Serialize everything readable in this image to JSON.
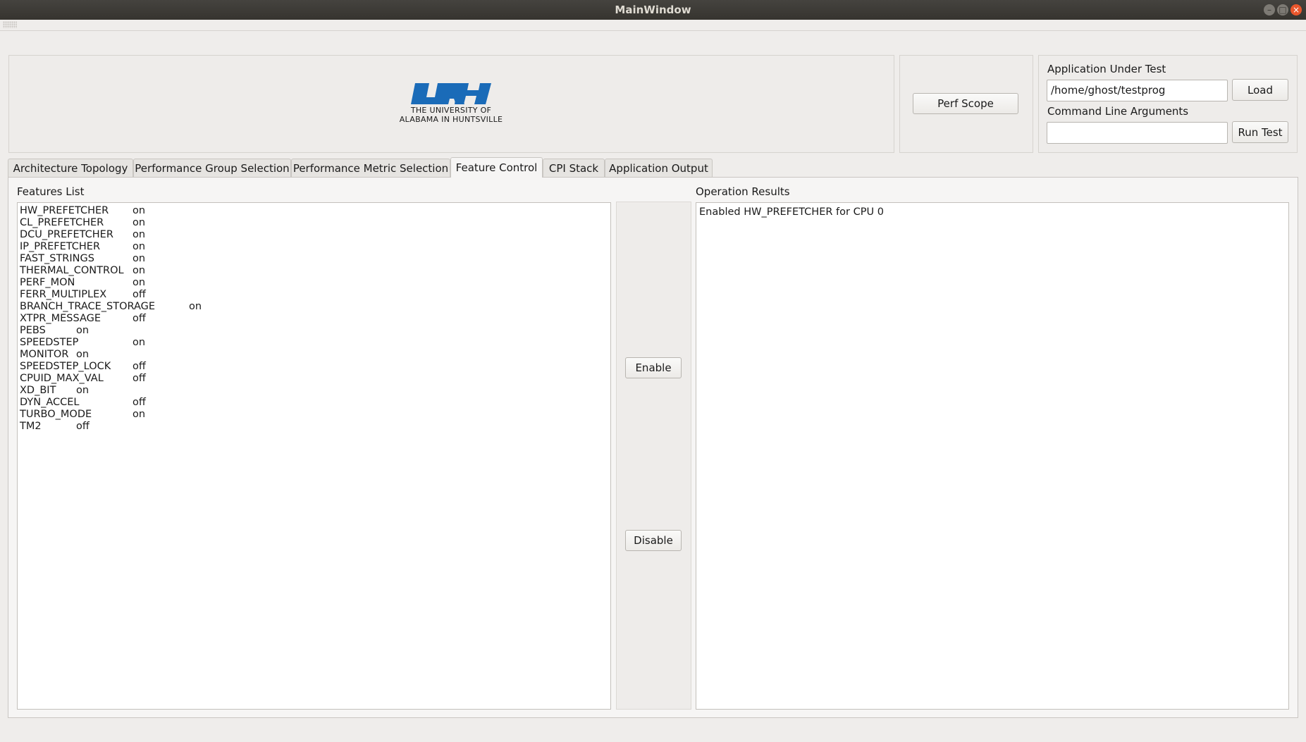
{
  "window": {
    "title": "MainWindow"
  },
  "logo": {
    "line1": "THE UNIVERSITY OF",
    "line2": "ALABAMA IN HUNTSVILLE",
    "color": "#1a6bb8"
  },
  "toolbar": {
    "perf_scope": "Perf Scope"
  },
  "app": {
    "under_test_label": "Application Under Test",
    "path_value": "/home/ghost/testprog",
    "load_label": "Load",
    "args_label": "Command Line Arguments",
    "args_value": "",
    "run_label": "Run Test"
  },
  "tabs": [
    {
      "label": "Architecture Topology"
    },
    {
      "label": "Performance Group Selection"
    },
    {
      "label": "Performance Metric Selection"
    },
    {
      "label": "Feature Control"
    },
    {
      "label": "CPI Stack"
    },
    {
      "label": "Application Output"
    }
  ],
  "active_tab": "Feature Control",
  "features": {
    "label": "Features List",
    "items": [
      {
        "name": "HW_PREFETCHER",
        "state": "on"
      },
      {
        "name": "CL_PREFETCHER",
        "state": "on"
      },
      {
        "name": "DCU_PREFETCHER",
        "state": "on"
      },
      {
        "name": "IP_PREFETCHER",
        "state": "on"
      },
      {
        "name": "FAST_STRINGS",
        "state": "on"
      },
      {
        "name": "THERMAL_CONTROL",
        "state": "on"
      },
      {
        "name": "PERF_MON",
        "state": "on"
      },
      {
        "name": "FERR_MULTIPLEX",
        "state": "off"
      },
      {
        "name": "BRANCH_TRACE_STORAGE",
        "state": "on"
      },
      {
        "name": "XTPR_MESSAGE",
        "state": "off"
      },
      {
        "name": "PEBS",
        "state": "on"
      },
      {
        "name": "SPEEDSTEP",
        "state": "on"
      },
      {
        "name": "MONITOR",
        "state": "on"
      },
      {
        "name": "SPEEDSTEP_LOCK",
        "state": "off"
      },
      {
        "name": "CPUID_MAX_VAL",
        "state": "off"
      },
      {
        "name": "XD_BIT",
        "state": "on"
      },
      {
        "name": "DYN_ACCEL",
        "state": "off"
      },
      {
        "name": "TURBO_MODE",
        "state": "on"
      },
      {
        "name": "TM2",
        "state": "off"
      }
    ]
  },
  "actions": {
    "enable": "Enable",
    "disable": "Disable"
  },
  "results": {
    "label": "Operation Results",
    "lines": [
      "Enabled HW_PREFETCHER for CPU 0"
    ]
  }
}
